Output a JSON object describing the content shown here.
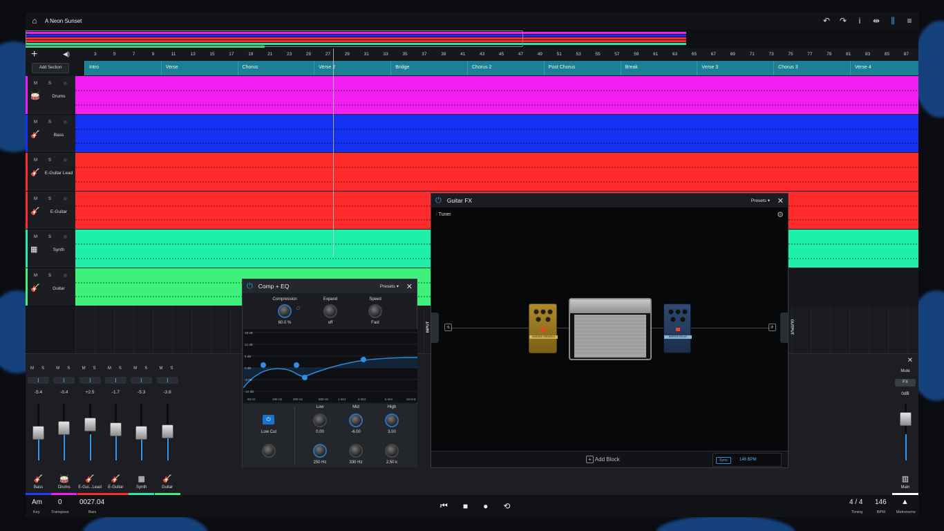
{
  "app": {
    "project_title": "A Neon Sunset"
  },
  "toolbar": {
    "icons": [
      "undo-icon",
      "redo-icon",
      "info-icon",
      "editor-icon",
      "mixer-icon",
      "menu-icon"
    ]
  },
  "ruler": {
    "bars": [
      "3",
      "5",
      "7",
      "9",
      "11",
      "13",
      "15",
      "17",
      "19",
      "21",
      "23",
      "25",
      "27",
      "29",
      "31",
      "33",
      "35",
      "37",
      "39",
      "41",
      "43",
      "45",
      "47",
      "49",
      "51",
      "53",
      "55",
      "57",
      "59",
      "61",
      "63",
      "65",
      "67",
      "69",
      "71",
      "73",
      "75",
      "77",
      "79",
      "81",
      "83",
      "85",
      "87"
    ]
  },
  "arrange": {
    "add_section_label": "Add Section",
    "sections": [
      "Intro",
      "Verse",
      "Chorus",
      "Verse 2",
      "Bridge",
      "Chorus 2",
      "Post Chorus",
      "Break",
      "Verse 3",
      "Chorus 3",
      "Verse 4"
    ]
  },
  "tracks": [
    {
      "name": "Drums",
      "color": "#f21ff2",
      "m": "M",
      "s": "S"
    },
    {
      "name": "Bass",
      "color": "#1430f0",
      "m": "M",
      "s": "S"
    },
    {
      "name": "E-Guitar Lead",
      "color": "#ff2a2a",
      "m": "M",
      "s": "S"
    },
    {
      "name": "E-Guitar",
      "color": "#ff2a2a",
      "m": "M",
      "s": "S"
    },
    {
      "name": "Synth",
      "color": "#1ef0a8",
      "m": "M",
      "s": "S"
    },
    {
      "name": "Guitar",
      "color": "#3ff07a",
      "m": "M",
      "s": "S"
    }
  ],
  "mixer": {
    "channels": [
      {
        "name": "Bass",
        "db": "-5.4",
        "line": "#1f3cff",
        "m": "M",
        "s": "S"
      },
      {
        "name": "Drums",
        "db": "-0.4",
        "line": "#f21ff2",
        "m": "M",
        "s": "S"
      },
      {
        "name": "E-Gui...Lead",
        "db": "+2.5",
        "line": "#ff2a2a",
        "m": "M",
        "s": "S"
      },
      {
        "name": "E-Guitar",
        "db": "-1.7",
        "line": "#ff2a2a",
        "m": "M",
        "s": "S"
      },
      {
        "name": "Synth",
        "db": "-5.3",
        "line": "#1ef0a8",
        "m": "M",
        "s": "S"
      },
      {
        "name": "Guitar",
        "db": "-3.8",
        "line": "#3ff07a",
        "m": "M",
        "s": "S"
      }
    ],
    "main": {
      "mute": "Mute",
      "fx": "FX",
      "db": "0dB",
      "name": "Main"
    }
  },
  "bottom": {
    "key_value": "Am",
    "key_label": "Key",
    "transpose_value": "0",
    "transpose_label": "Transpose",
    "bars_value": "0027.04",
    "bars_label": "Bars",
    "timing_value": "4 / 4",
    "timing_label": "Timing",
    "bpm_value": "146",
    "bpm_label": "BPM",
    "metronome_label": "Metronome"
  },
  "comp_eq": {
    "title": "Comp + EQ",
    "presets": "Presets",
    "compression_label": "Compression",
    "compression_value": "60.0 %",
    "expand_label": "Expand",
    "expand_value": "off",
    "speed_label": "Speed",
    "speed_value": "Fast",
    "db_ticks": [
      "18 dB",
      "12 dB",
      "6 dB",
      "0 dB",
      "-6 dB",
      "-12 dB"
    ],
    "freq_ticks": [
      "50 Hz",
      "100 Hz",
      "200 Hz",
      "500 Hz",
      "1 kHz",
      "2 kHz",
      "5 kHz",
      "10 kHz"
    ],
    "low_cut_label": "Low Cut",
    "low_label": "Low",
    "low_value": "0.00",
    "mid_label": "Mid",
    "mid_value": "-6.00",
    "high_label": "High",
    "high_value": "3.00",
    "low_freq": "250 Hz",
    "mid_freq": "330 Hz",
    "high_freq": "2.50 k"
  },
  "guitar_fx": {
    "title": "Guitar FX",
    "presets": "Presets",
    "tuner": "Tuner",
    "input": "INPUT",
    "output": "OUTPUT",
    "add_block": "Add Block",
    "sync": "Sync",
    "bpm": "146 BPM",
    "pedal1": "VINTAGE TREMOLO",
    "pedal2": "MIRROR DELAY"
  }
}
